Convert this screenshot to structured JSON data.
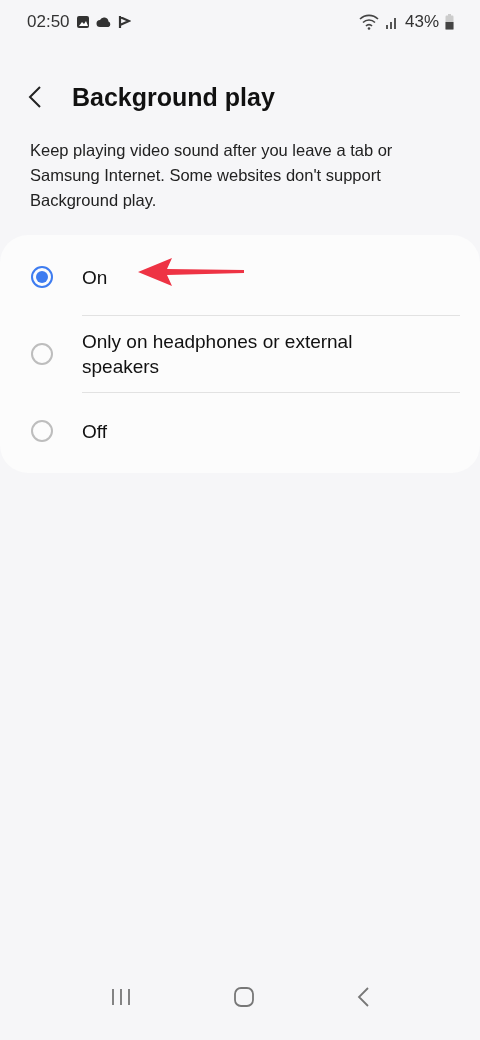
{
  "status_bar": {
    "time": "02:50",
    "battery": "43%"
  },
  "header": {
    "title": "Background play"
  },
  "description": "Keep playing video sound after you leave a tab or Samsung Internet. Some websites don't support Background play.",
  "options": [
    {
      "label": "On",
      "selected": true
    },
    {
      "label": "Only on headphones or external speakers",
      "selected": false
    },
    {
      "label": "Off",
      "selected": false
    }
  ]
}
